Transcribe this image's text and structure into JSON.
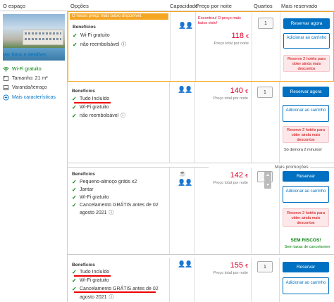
{
  "header": {
    "col_space": "O espaço",
    "col_options": "Opções",
    "col_capacity": "Capacidade",
    "col_price": "Preço por noite",
    "col_rooms": "Quartos",
    "col_most": "Mais reservado"
  },
  "left": {
    "photos_link": "Ver fotos e detalhes",
    "amenities": [
      {
        "icon": "wifi-icon",
        "label": "Wi-Fi gratuito",
        "green": true
      },
      {
        "icon": "size-icon",
        "label": "Tamanho: 21 m²",
        "green": false
      },
      {
        "icon": "balcony-icon",
        "label": "Varanda/terraço",
        "green": false
      }
    ],
    "more_link": "Mais características"
  },
  "rooms": [
    {
      "banner": "O nosso preço mais baixo disponível.",
      "benefits_label": "Benefícios",
      "features": [
        "Wi-Fi gratuito",
        "não reembolsável"
      ],
      "found_note": "Encontrou! O preço mais baixo visto!",
      "price": "118",
      "currency": "€",
      "price_note": "Preço total por noite",
      "qty": "1",
      "reserve": "Reservar agora",
      "add_cart": "Adicionar ao carrinho",
      "scarcity": "Reserve 2 hotéis para obter ainda mais descontos"
    },
    {
      "benefits_label": "Benefícios",
      "features": [
        "Tudo Incluído",
        "Wi-Fi gratuito",
        "não reembolsável"
      ],
      "price": "140",
      "currency": "€",
      "price_note": "Preço total por noite",
      "qty": "1",
      "reserve": "Reservar agora",
      "add_cart": "Adicionar ao carrinho",
      "scarcity": "Reserve 2 hotéis para obter ainda mais descontos",
      "note": "Só demora 2 minutos!"
    },
    {
      "benefits_label": "Benefícios",
      "features": [
        "Pequeno-almoço grátis x2",
        "Jantar",
        "Wi-Fi gratuito",
        "Cancelamento GRÁTIS antes de 02",
        "agosto 2021"
      ],
      "price": "142",
      "currency": "€",
      "price_note": "Preço total por noite",
      "qty": "1",
      "reserve": "Reservar",
      "add_cart": "Adicionar ao carrinho",
      "scarcity": "Reserve 2 hotéis para obter ainda mais descontos",
      "no_risk": "SEM RISCOS!",
      "no_fees": "Sem taxas de cancelamen"
    },
    {
      "benefits_label": "Benefícios",
      "features": [
        "Tudo Incluído",
        "Wi-Fi gratuito",
        "Cancelamento GRÁTIS antes de 02",
        "agosto 2021"
      ],
      "price": "155",
      "currency": "€",
      "price_note": "Preço total por noite",
      "qty": "1",
      "reserve": "Reservar",
      "add_cart": "Adicionar ao carrinho"
    }
  ],
  "more_promos": "Mais promoções",
  "colors": {
    "accent": "#0071c2",
    "price": "#e0002a",
    "green": "#008009",
    "banner": "#f5a623"
  }
}
